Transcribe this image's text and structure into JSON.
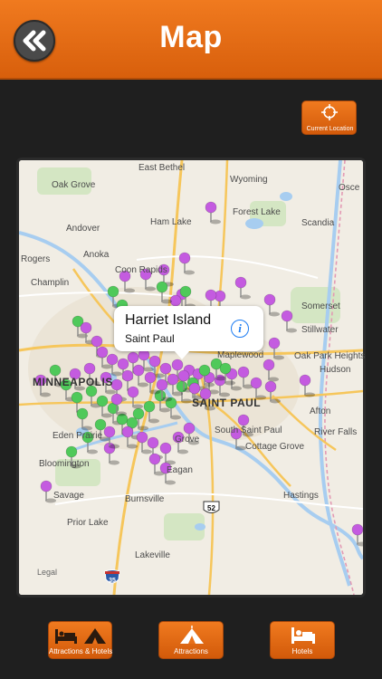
{
  "header": {
    "title": "Map",
    "back_icon": "double-chevron-left-icon"
  },
  "current_location": {
    "label": "Current Location",
    "icon": "crosshair-icon"
  },
  "map": {
    "places": [
      {
        "name": "East Bethel"
      },
      {
        "name": "Wyoming"
      },
      {
        "name": "Oak Grove"
      },
      {
        "name": "Osce"
      },
      {
        "name": "Forest Lake"
      },
      {
        "name": "Ham Lake"
      },
      {
        "name": "Scandia"
      },
      {
        "name": "Andover"
      },
      {
        "name": "Anoka"
      },
      {
        "name": "Rogers"
      },
      {
        "name": "Coon Rapids"
      },
      {
        "name": "Champlin"
      },
      {
        "name": "Somerset"
      },
      {
        "name": "Stillwater"
      },
      {
        "name": "Oak Park Heights"
      },
      {
        "name": "Hudson"
      },
      {
        "name": "Maplewood"
      },
      {
        "name": "MINNEAPOLIS"
      },
      {
        "name": "SAINT PAUL"
      },
      {
        "name": "South Saint Paul"
      },
      {
        "name": "Afton"
      },
      {
        "name": "River Falls"
      },
      {
        "name": "Eden Prairie"
      },
      {
        "name": "Bloomington"
      },
      {
        "name": "Cottage Grove"
      },
      {
        "name": "Eagan"
      },
      {
        "name": "Savage"
      },
      {
        "name": "Burnsville"
      },
      {
        "name": "Hastings"
      },
      {
        "name": "Prior Lake"
      },
      {
        "name": "Lakeville"
      },
      {
        "name": "Grove"
      }
    ],
    "highway_shields": [
      "35",
      "52"
    ],
    "legal_label": "Legal",
    "callout": {
      "title": "Harriet Island",
      "subtitle": "Saint Paul",
      "info_icon": "info-icon"
    },
    "pin_colors": {
      "attraction": "#c45be0",
      "hotel": "#4fc95a"
    }
  },
  "bottom_bar": {
    "buttons": [
      {
        "label": "Attractions & Hotels",
        "icon": "bed-and-tent-icon"
      },
      {
        "label": "Attractions",
        "icon": "tent-icon"
      },
      {
        "label": "Hotels",
        "icon": "bed-icon"
      }
    ]
  },
  "colors": {
    "accent": "#e8701a",
    "background": "#1f1f1f"
  }
}
